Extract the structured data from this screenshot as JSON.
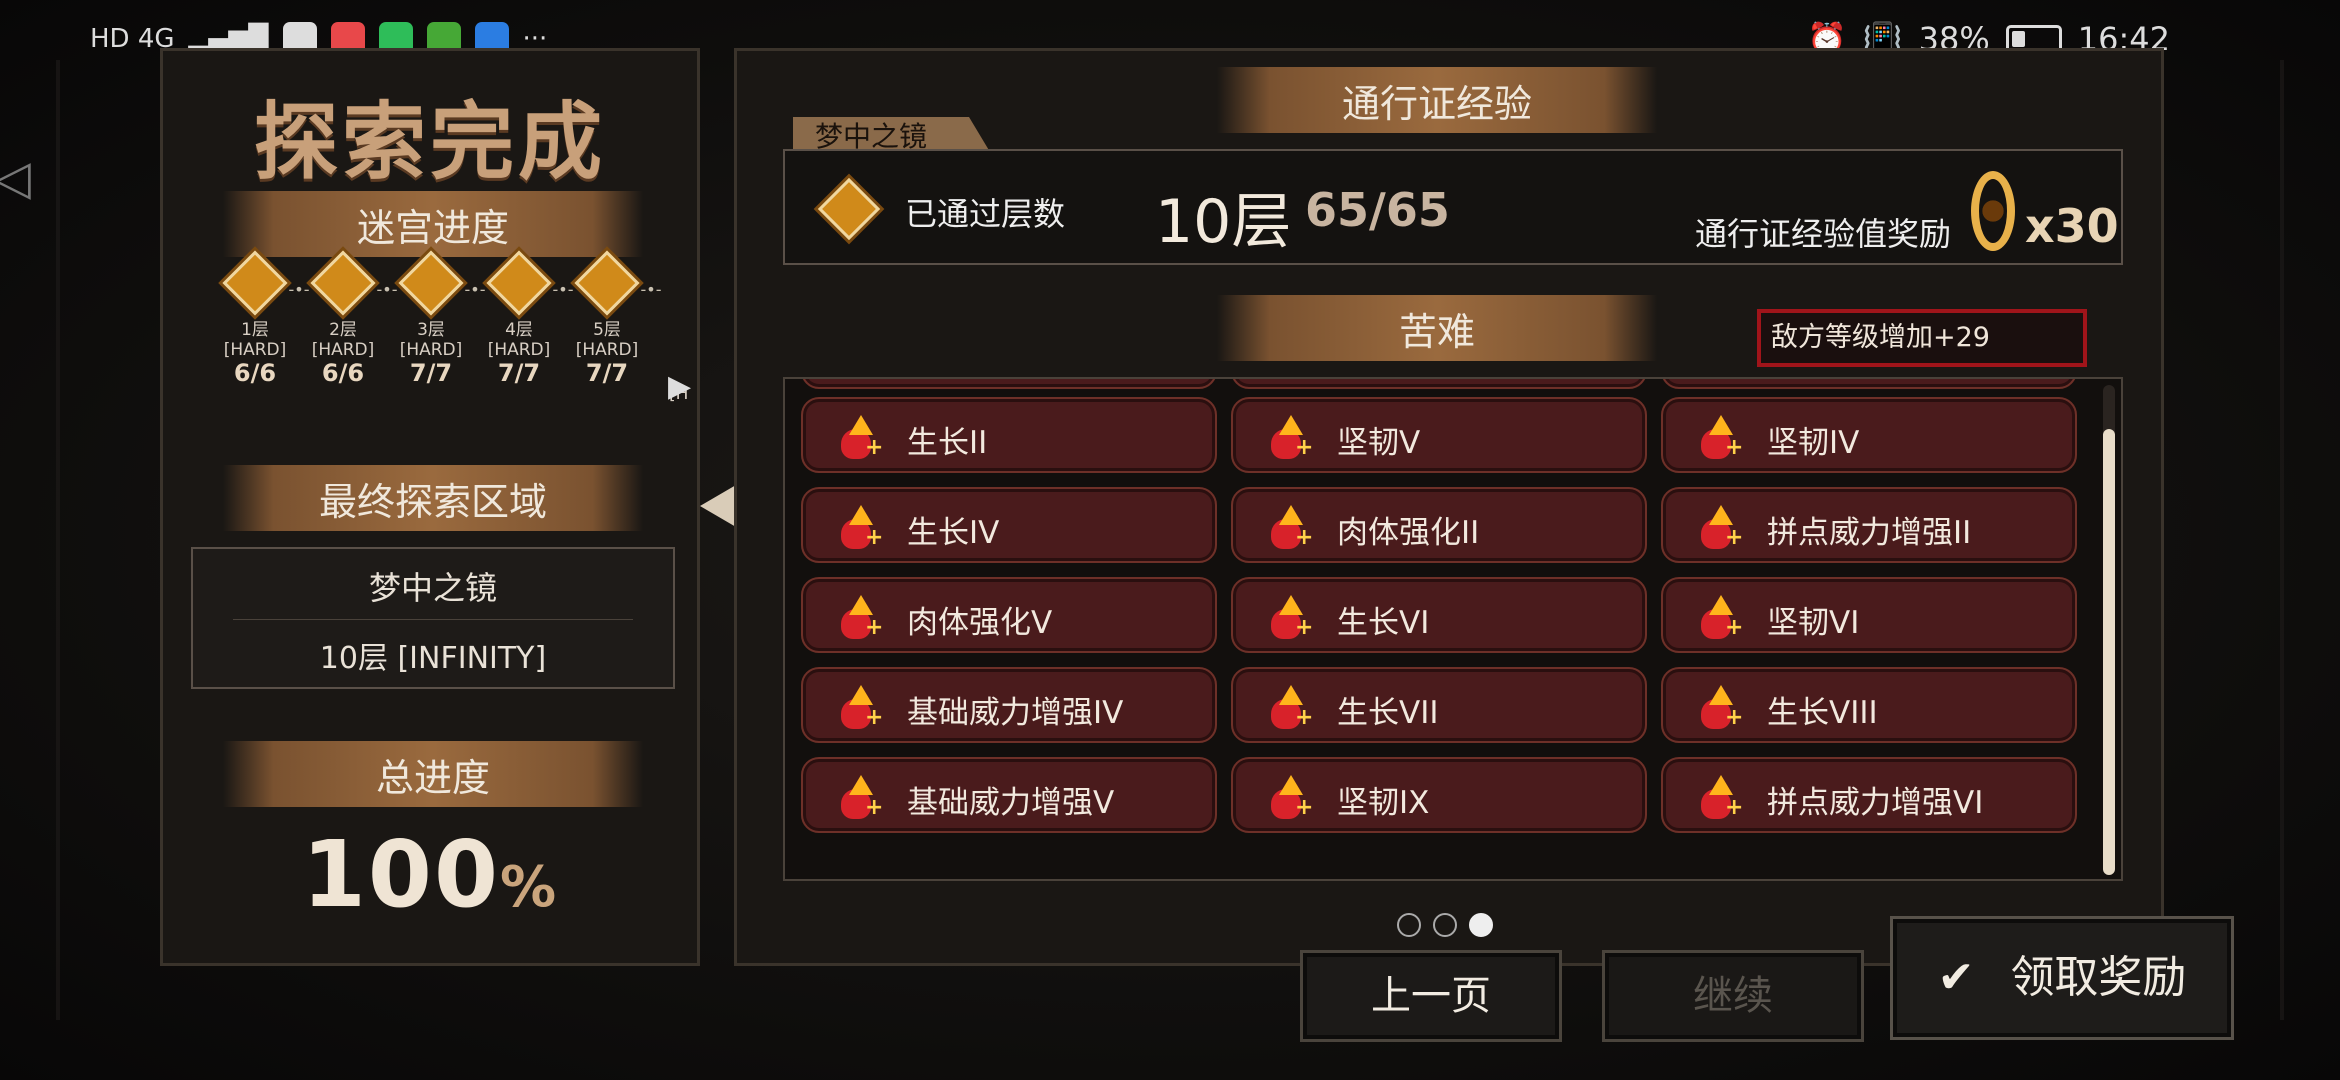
{
  "status_bar": {
    "left_text": "HD 4G",
    "battery": "38%",
    "battery_fraction": 0.38,
    "time": "16:42",
    "more": "···",
    "app_chip_colors": [
      "#e8484a",
      "#2ebd59",
      "#46a836",
      "#2b7de2"
    ]
  },
  "left": {
    "title": "探索完成",
    "maze_progress_label": "迷宫进度",
    "floors": [
      {
        "floor": "1层",
        "difficulty": "[HARD]",
        "count": "6/6"
      },
      {
        "floor": "2层",
        "difficulty": "[HARD]",
        "count": "6/6"
      },
      {
        "floor": "3层",
        "difficulty": "[HARD]",
        "count": "7/7"
      },
      {
        "floor": "4层",
        "difficulty": "[HARD]",
        "count": "7/7"
      },
      {
        "floor": "5层",
        "difficulty": "[HARD]",
        "count": "7/7"
      }
    ],
    "floor_truncated": "[H",
    "final_area_label": "最终探索区域",
    "final_area_name": "梦中之镜",
    "final_area_floor": "10层 [INFINITY]",
    "total_label": "总进度",
    "total_value": "100",
    "total_unit": "%"
  },
  "right": {
    "pass_exp_title": "通行证经验",
    "pass_tab": "梦中之镜",
    "passed_label": "已通过层数",
    "passed_floor": "10层",
    "passed_count": "65/65",
    "reward_label": "通行证经验值奖励",
    "reward_multiplier": "x30",
    "hardship_title": "苦难",
    "enemy_level": "敌方等级增加+29",
    "buffs": [
      [
        "生长II",
        "坚韧V",
        "坚韧IV"
      ],
      [
        "生长IV",
        "肉体强化II",
        "拼点威力增强II"
      ],
      [
        "肉体强化V",
        "生长VI",
        "坚韧VI"
      ],
      [
        "基础威力增强IV",
        "生长VII",
        "生长VIII"
      ],
      [
        "基础威力增强V",
        "坚韧IX",
        "拼点威力增强VI"
      ]
    ],
    "page_dots": 3,
    "active_page": 3
  },
  "buttons": {
    "prev": "上一页",
    "continue": "继续",
    "claim": "领取奖励"
  },
  "colors": {
    "accent": "#c8a07a",
    "buff_bg": "#4a1b1c",
    "enemy_border": "#a0141a"
  },
  "icons": {
    "back_arrow": "triangle-left-icon",
    "next_arrow": "triangle-right-icon",
    "claim": "check-icon",
    "buff": "heart-arrow-plus-icon"
  }
}
